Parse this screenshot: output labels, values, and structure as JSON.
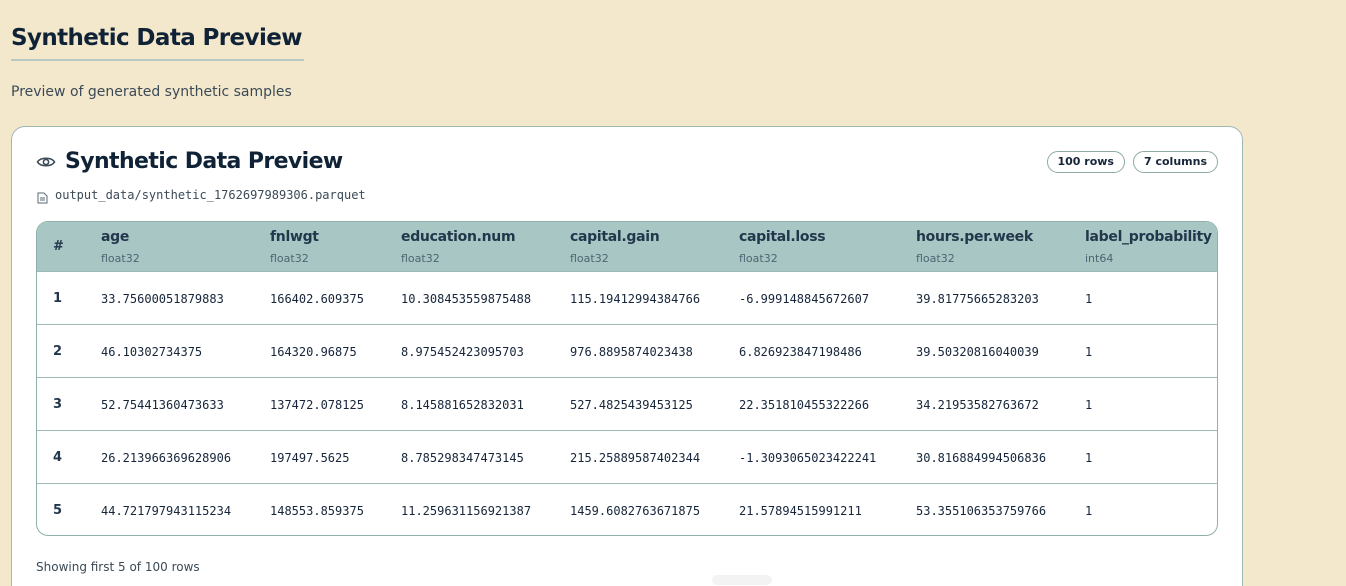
{
  "page": {
    "title": "Synthetic Data Preview",
    "subtitle": "Preview of generated synthetic samples"
  },
  "card": {
    "title": "Synthetic Data Preview",
    "title_icon": "eye-icon",
    "file_icon": "file-icon",
    "file_path": "output_data/synthetic_1762697989306.parquet",
    "badges": {
      "rows": "100 rows",
      "columns": "7 columns"
    },
    "footer": "Showing first 5 of 100 rows"
  },
  "table": {
    "index_header": "#",
    "columns": [
      {
        "name": "age",
        "dtype": "float32"
      },
      {
        "name": "fnlwgt",
        "dtype": "float32"
      },
      {
        "name": "education.num",
        "dtype": "float32"
      },
      {
        "name": "capital.gain",
        "dtype": "float32"
      },
      {
        "name": "capital.loss",
        "dtype": "float32"
      },
      {
        "name": "hours.per.week",
        "dtype": "float32"
      },
      {
        "name": "label_probability",
        "dtype": "int64"
      }
    ],
    "rows": [
      {
        "idx": "1",
        "cells": [
          "33.75600051879883",
          "166402.609375",
          "10.308453559875488",
          "115.19412994384766",
          "-6.999148845672607",
          "39.81775665283203",
          "1"
        ]
      },
      {
        "idx": "2",
        "cells": [
          "46.10302734375",
          "164320.96875",
          "8.975452423095703",
          "976.8895874023438",
          "6.826923847198486",
          "39.50320816040039",
          "1"
        ]
      },
      {
        "idx": "3",
        "cells": [
          "52.75441360473633",
          "137472.078125",
          "8.145881652832031",
          "527.4825439453125",
          "22.351810455322266",
          "34.21953582763672",
          "1"
        ]
      },
      {
        "idx": "4",
        "cells": [
          "26.213966369628906",
          "197497.5625",
          "8.785298347473145",
          "215.25889587402344",
          "-1.3093065023422241",
          "30.816884994506836",
          "1"
        ]
      },
      {
        "idx": "5",
        "cells": [
          "44.721797943115234",
          "148553.859375",
          "11.259631156921387",
          "1459.6082763671875",
          "21.57894515991211",
          "53.355106353759766",
          "1"
        ]
      }
    ]
  },
  "colors": {
    "background": "#f4e8cc",
    "header_row": "#a8c7c4",
    "border": "#9fb9b5",
    "title": "#0f2236"
  }
}
